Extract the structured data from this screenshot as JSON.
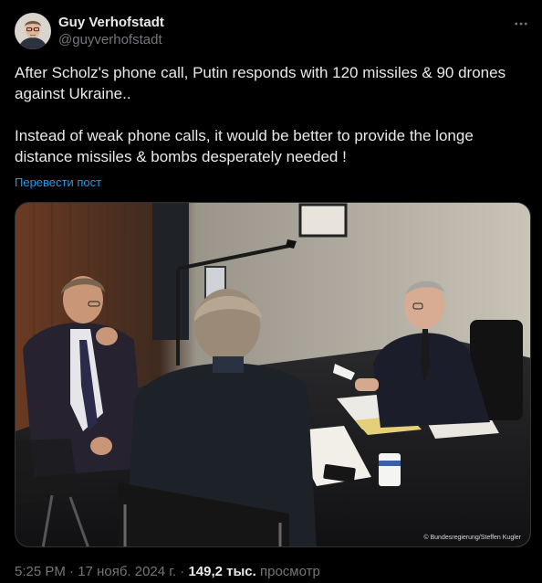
{
  "author": {
    "display_name": "Guy Verhofstadt",
    "handle": "@guyverhofstadt",
    "avatar_icon": "avatar-portrait"
  },
  "more_icon": "ellipsis-icon",
  "tweet": {
    "text": "After Scholz's phone call, Putin responds with 120 missiles & 90 drones against Ukraine..\n\nInstead of weak phone calls, it would be better to provide the longe distance missiles & bombs desperately needed !",
    "translate_label": "Перевести пост"
  },
  "media": {
    "credit": "© Bundesregierung/Steffen Kugler"
  },
  "meta": {
    "time": "5:25 PM",
    "separator": "·",
    "date": "17 нояб. 2024 г.",
    "views_count": "149,2 тыс.",
    "views_label": "просмотр"
  },
  "colors": {
    "background": "#000000",
    "text": "#e7e9ea",
    "muted": "#71767b",
    "link": "#1d9bf0"
  }
}
